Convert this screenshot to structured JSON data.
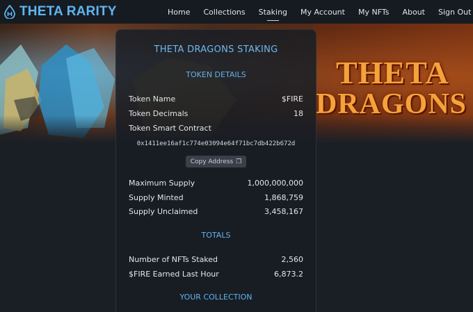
{
  "brand": {
    "name": "THETA RARITY",
    "logo_icon": "theta-drop-icon",
    "accent": "#5fb6f2"
  },
  "nav": {
    "items": [
      {
        "label": "Home",
        "active": false
      },
      {
        "label": "Collections",
        "active": false
      },
      {
        "label": "Staking",
        "active": true
      },
      {
        "label": "My Account",
        "active": false
      },
      {
        "label": "My NFTs",
        "active": false
      },
      {
        "label": "About",
        "active": false
      },
      {
        "label": "Sign Out",
        "active": false
      }
    ]
  },
  "banner": {
    "title_line1": "THETA",
    "title_line2": "DRAGONS"
  },
  "staking": {
    "title": "THETA DRAGONS STAKING",
    "token_details": {
      "heading": "TOKEN DETAILS",
      "token_name_label": "Token Name",
      "token_name_value": "$FIRE",
      "token_decimals_label": "Token Decimals",
      "token_decimals_value": "18",
      "contract_label": "Token Smart Contract",
      "contract_address": "0x1411ee16af1c774e03094e64f71bc7db422b672d",
      "copy_button_label": "Copy Address",
      "copy_icon": "copy-icon"
    },
    "supply": {
      "max_label": "Maximum Supply",
      "max_value": "1,000,000,000",
      "minted_label": "Supply Minted",
      "minted_value": "1,868,759",
      "unclaimed_label": "Supply Unclaimed",
      "unclaimed_value": "3,458,167"
    },
    "totals": {
      "heading": "TOTALS",
      "staked_label": "Number of NFTs Staked",
      "staked_value": "2,560",
      "earned_label": "$FIRE Earned Last Hour",
      "earned_value": "6,873.2"
    },
    "collection_heading": "YOUR COLLECTION"
  }
}
